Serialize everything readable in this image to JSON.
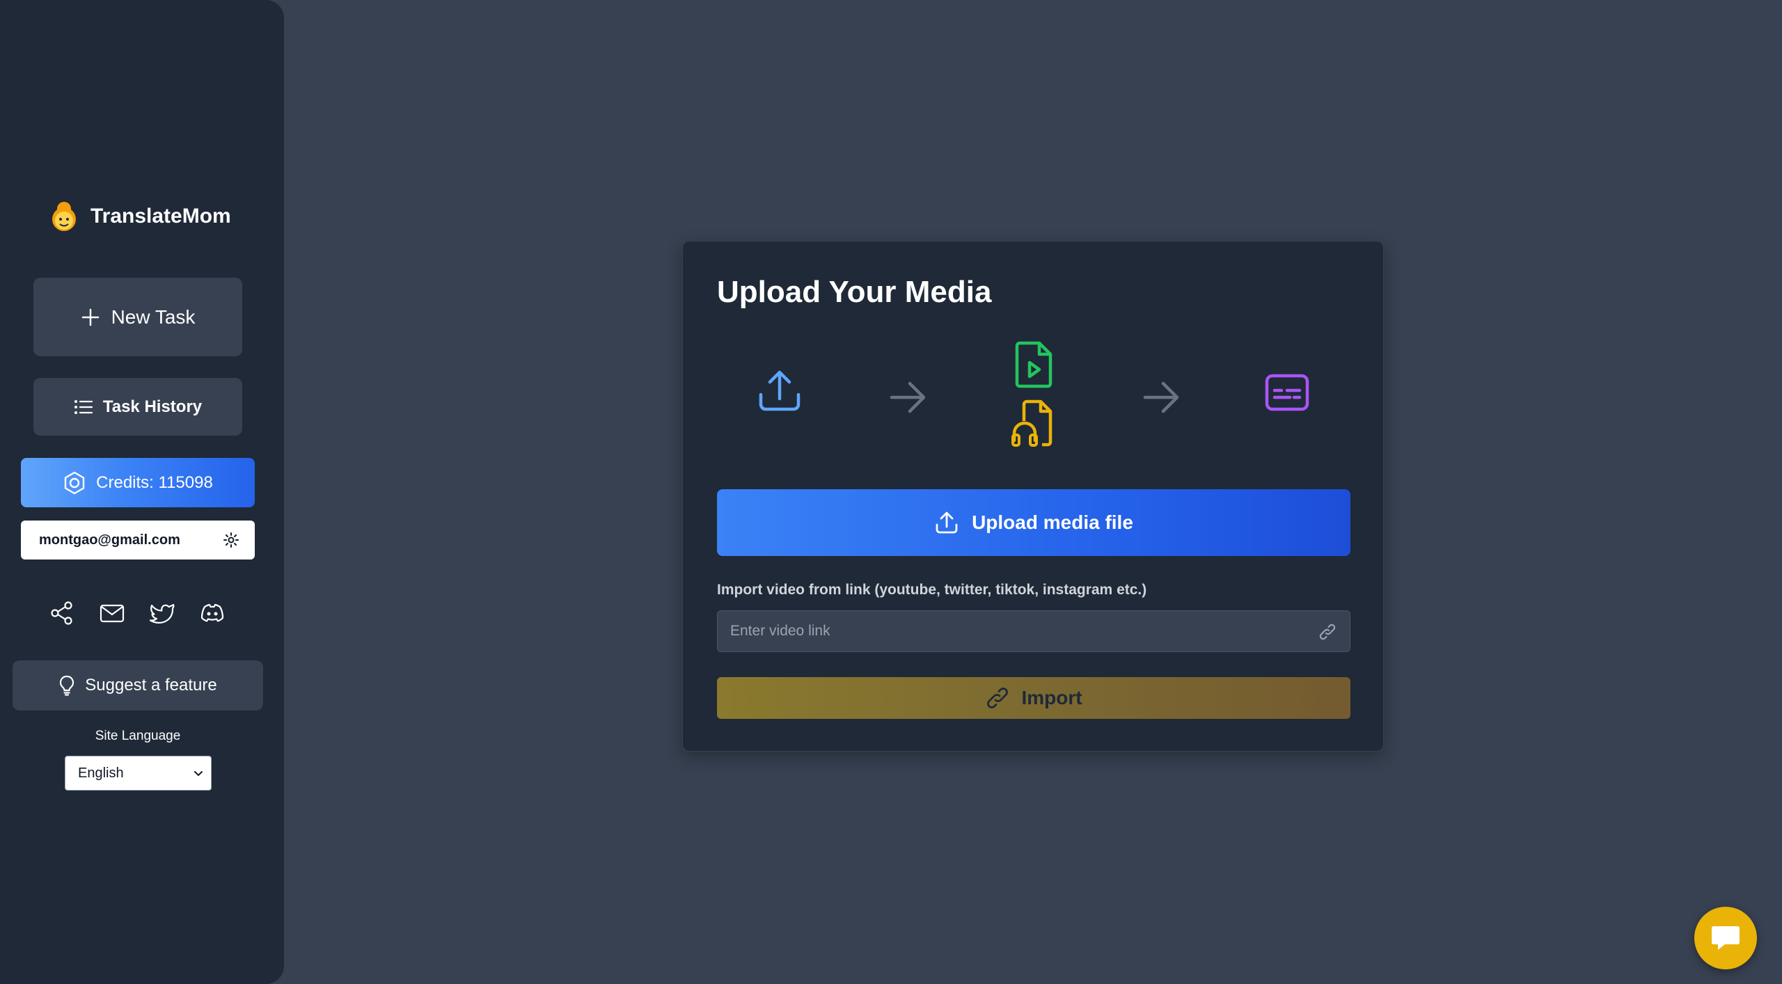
{
  "sidebar": {
    "brand": "TranslateMom",
    "new_task_label": "New Task",
    "task_history_label": "Task History",
    "credits_label": "Credits: 115098",
    "user_email": "montgao@gmail.com",
    "social_icons": [
      "share-icon",
      "mail-icon",
      "twitter-icon",
      "discord-icon"
    ],
    "suggest_label": "Suggest a feature",
    "site_language_label": "Site Language",
    "site_language_value": "English"
  },
  "upload_card": {
    "title": "Upload Your Media",
    "flow_icons": [
      "upload-icon",
      "arrow-right-icon",
      "video-file-icon",
      "audio-file-icon",
      "arrow-right-icon",
      "subtitles-icon"
    ],
    "upload_button_label": "Upload media file",
    "import_label": "Import video from link (youtube, twitter, tiktok, instagram etc.)",
    "link_placeholder": "Enter video link",
    "import_button_label": "Import"
  },
  "colors": {
    "sidebar_bg": "#1f2937",
    "page_bg": "#374151",
    "accent_blue": "#3b82f6",
    "accent_gold": "#eab308",
    "icon_green": "#22c55e",
    "icon_yellow": "#eab308",
    "icon_purple": "#a855f7"
  }
}
